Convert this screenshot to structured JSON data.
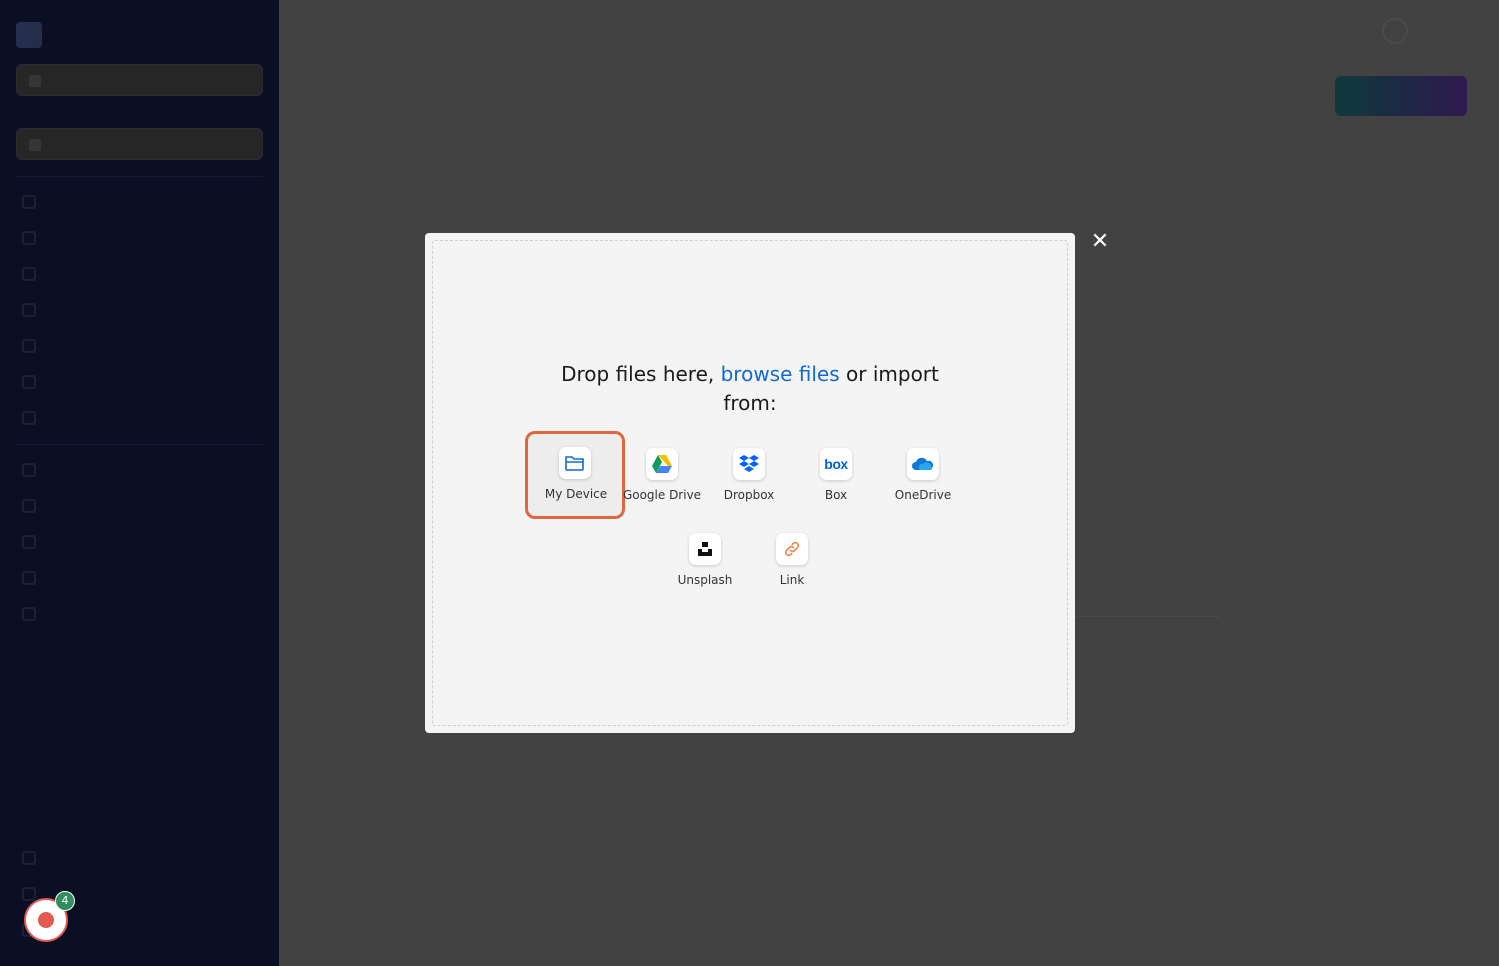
{
  "modal": {
    "prompt_before": "Drop files here,",
    "prompt_link": "browse files",
    "prompt_after": "or import from:",
    "close_symbol": "✕",
    "sources": [
      {
        "label": "My Device",
        "icon": "folder-icon"
      },
      {
        "label": "Google Drive",
        "icon": "google-drive-icon"
      },
      {
        "label": "Dropbox",
        "icon": "dropbox-icon"
      },
      {
        "label": "Box",
        "icon": "box-icon"
      },
      {
        "label": "OneDrive",
        "icon": "onedrive-icon"
      },
      {
        "label": "Unsplash",
        "icon": "unsplash-icon"
      },
      {
        "label": "Link",
        "icon": "link-icon"
      }
    ],
    "box_logo_text": "box"
  },
  "recorder": {
    "badge_count": "4"
  },
  "colors": {
    "link": "#1269cf",
    "selected_border": "#e0663f",
    "recorder_red": "#e35b4f",
    "badge_green": "#2f8f5f"
  }
}
